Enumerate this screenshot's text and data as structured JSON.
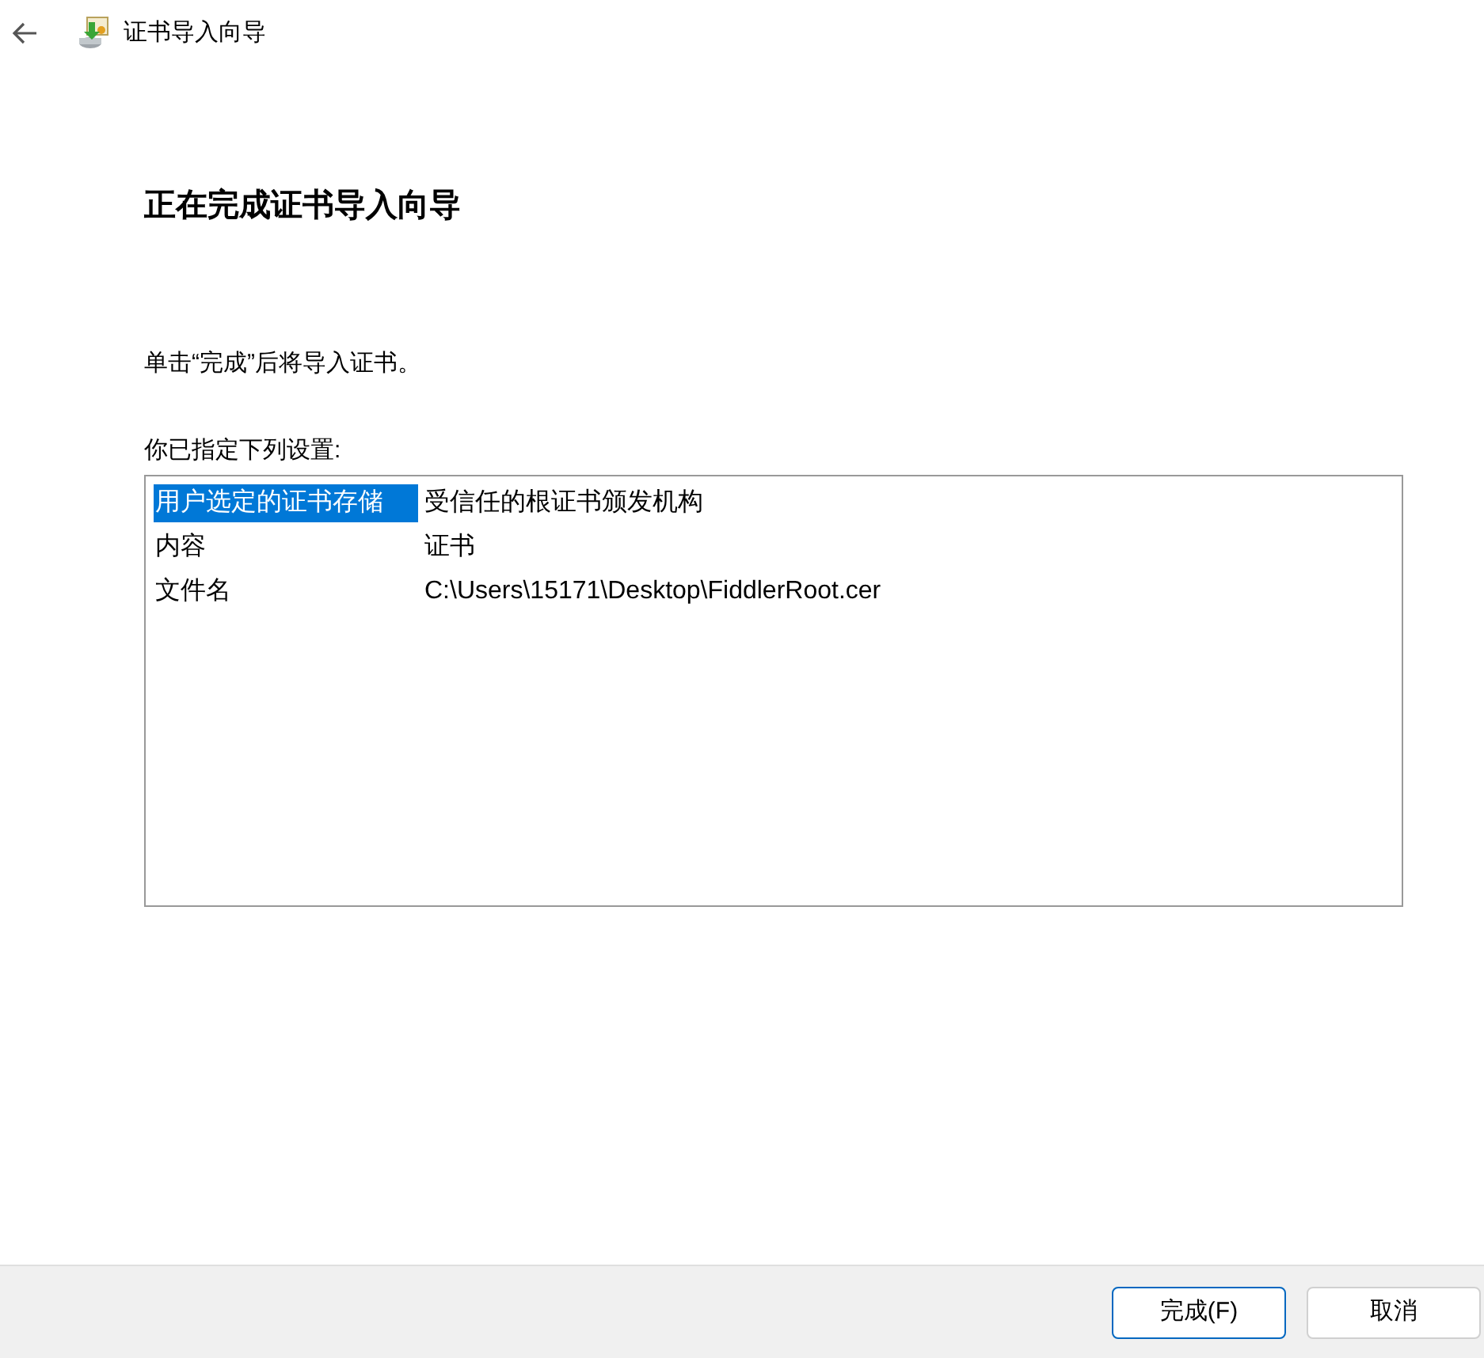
{
  "window": {
    "title": "证书导入向导"
  },
  "heading": "正在完成证书导入向导",
  "instruction": "单击“完成”后将导入证书。",
  "settings_label": "你已指定下列设置:",
  "settings": [
    {
      "name": "用户选定的证书存储",
      "value": "受信任的根证书颁发机构",
      "selected": true
    },
    {
      "name": "内容",
      "value": "证书",
      "selected": false
    },
    {
      "name": "文件名",
      "value": "C:\\Users\\15171\\Desktop\\FiddlerRoot.cer",
      "selected": false
    }
  ],
  "buttons": [
    {
      "label": "完成(F)",
      "kind": "default"
    },
    {
      "label": "取消",
      "kind": "normal"
    }
  ]
}
